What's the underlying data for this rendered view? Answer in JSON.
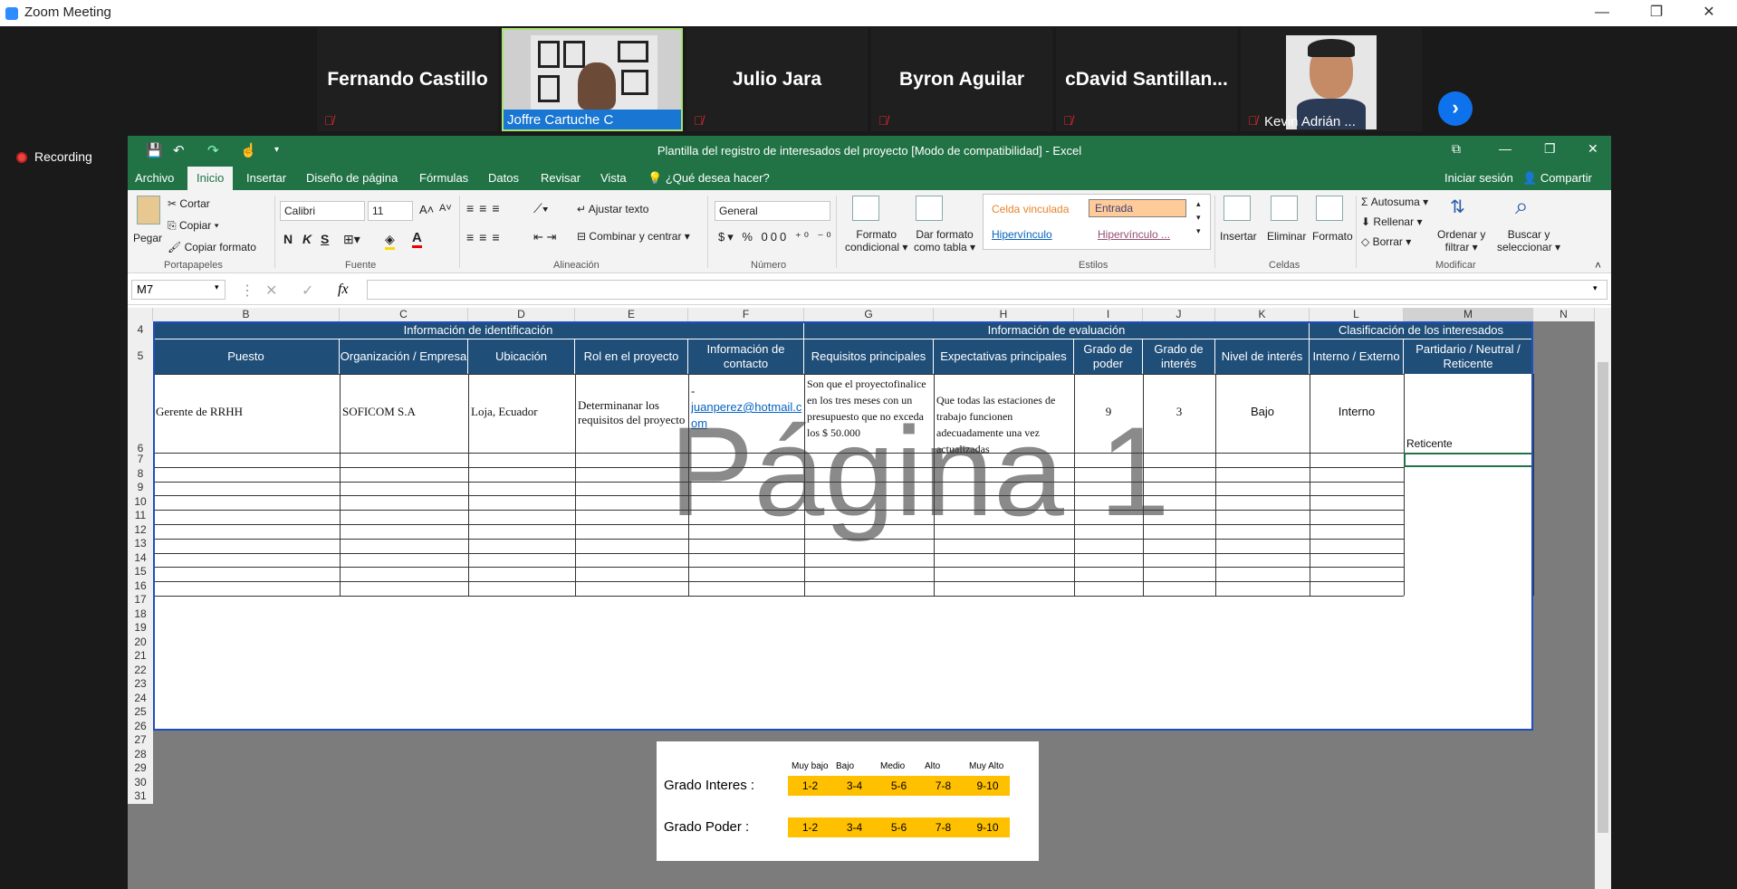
{
  "zoom": {
    "title": "Zoom Meeting",
    "recording_label": "Recording",
    "participants": [
      {
        "name": "Fernando Castillo",
        "muted": true
      },
      {
        "name": "Joffre Cartuche C",
        "muted": false,
        "has_video": true
      },
      {
        "name": "Julio Jara",
        "muted": true
      },
      {
        "name": "Byron Aguilar",
        "muted": true
      },
      {
        "name": "cDavid  Santillan...",
        "muted": true
      },
      {
        "name": "Kevin Adrián ...",
        "muted": true,
        "has_video": true
      }
    ]
  },
  "excel": {
    "doc_title": "Plantilla del registro de interesados del proyecto  [Modo de compatibilidad] - Excel",
    "tabs": [
      "Archivo",
      "Inicio",
      "Insertar",
      "Diseño de página",
      "Fórmulas",
      "Datos",
      "Revisar",
      "Vista",
      "¿Qué desea hacer?"
    ],
    "active_tab": "Inicio",
    "sign_in": "Iniciar sesión",
    "share": "Compartir",
    "ribbon": {
      "paste": "Pegar",
      "cut": "Cortar",
      "copy": "Copiar",
      "copy_format": "Copiar formato",
      "font_name": "Calibri",
      "font_size": "11",
      "wrap_text": "Ajustar texto",
      "merge_center": "Combinar y centrar",
      "number_format": "General",
      "cond_format_1": "Formato",
      "cond_format_2": "condicional",
      "table_format_1": "Dar formato",
      "table_format_2": "como tabla",
      "style_linked": "Celda vinculada",
      "style_input": "Entrada",
      "style_hyperlink": "Hipervínculo",
      "style_hyperlink2": "Hipervínculo ...",
      "insert": "Insertar",
      "delete": "Eliminar",
      "format": "Formato",
      "autosum": "Autosuma",
      "fill": "Rellenar",
      "clear": "Borrar",
      "sort_1": "Ordenar y",
      "sort_2": "filtrar",
      "find_1": "Buscar y",
      "find_2": "seleccionar",
      "groups": [
        "Portapapeles",
        "Fuente",
        "Alineación",
        "Número",
        "Estilos",
        "Celdas",
        "Modificar"
      ],
      "bold": "N",
      "italic": "K",
      "underline": "S"
    },
    "name_box": "M7",
    "fx": "fx",
    "columns": [
      "B",
      "C",
      "D",
      "E",
      "F",
      "G",
      "H",
      "I",
      "J",
      "K",
      "L",
      "M",
      "N"
    ],
    "rows": [
      "4",
      "5",
      "6",
      "7",
      "8",
      "9",
      "10",
      "11",
      "12",
      "13",
      "14",
      "15",
      "16",
      "17",
      "18",
      "19",
      "20",
      "21",
      "22",
      "23",
      "24",
      "25",
      "26",
      "27",
      "28",
      "29",
      "30",
      "31"
    ],
    "group_headers": {
      "identificacion": "Información de identificación",
      "evaluacion": "Información de evaluación",
      "clasificacion": "Clasificación de los interesados"
    },
    "headers": {
      "B": "Puesto",
      "C": "Organización / Empresa",
      "D": "Ubicación",
      "E": "Rol en el proyecto",
      "F": "Información de contacto",
      "G": "Requisitos principales",
      "H": "Expectativas principales",
      "I": "Grado de poder",
      "J": "Grado de interés",
      "K": "Nivel de interés",
      "L": "Interno / Externo",
      "M": "Partidario / Neutral / Reticente"
    },
    "row6": {
      "B": "Gerente de RRHH",
      "C": "SOFICOM S.A",
      "D": "Loja, Ecuador",
      "E": "Determinanar los requisitos del proyecto",
      "F_dash": "-",
      "F": "juanperez@hotmail.com",
      "G": "Son que el proyectofinalice en los tres meses con un presupuesto que no exceda los $ 50.000",
      "H": " Que todas las estaciones de trabajo funcionen adecuadamente una vez actualizadas",
      "I": "9",
      "J": "3",
      "K": "Bajo",
      "L": "Interno",
      "M": "Reticente"
    },
    "watermark": "Página 1",
    "legend": {
      "levels": [
        "Muy bajo",
        "Bajo",
        "Medio",
        "Alto",
        "Muy Alto"
      ],
      "interes_label": "Grado Interes :",
      "poder_label": "Grado Poder :",
      "ranges": [
        "1-2",
        "3-4",
        "5-6",
        "7-8",
        "9-10"
      ]
    }
  },
  "colors": {
    "excel_green": "#217346",
    "header_blue": "#1f4e79",
    "legend_yellow": "#ffc000"
  }
}
